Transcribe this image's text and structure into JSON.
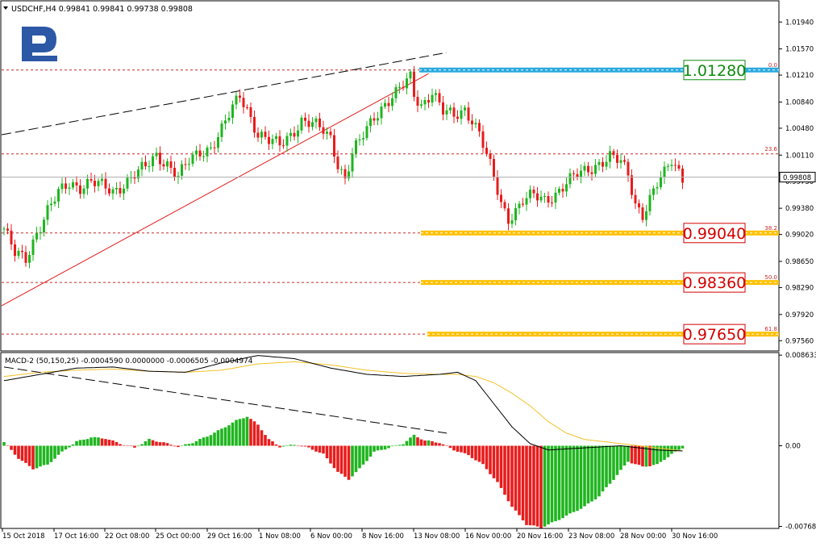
{
  "header": {
    "symbol_line": "USDCHF,H4  0.99841 0.99841 0.99738 0.99808"
  },
  "macd_header": "MACD-2 (50,150,25) -0.0004590 0.0000000 -0.0006505 -0.0004974",
  "colors": {
    "bull": "#1FB51F",
    "bear": "#E81C1C",
    "dashed": "#C62828",
    "blue_zone": "#2AA9DF",
    "orange_zone": "#FFC000",
    "price_box": "#D50000",
    "green_box": "#0E8A0E",
    "logo": "#2C58A6"
  },
  "chart_data": [
    {
      "type": "candlestick",
      "title": "USDCHF,H4",
      "ylim": [
        0.9743,
        1.0222
      ],
      "y_ticks": [
        "1.01940",
        "1.01570",
        "1.01210",
        "1.00840",
        "1.00480",
        "1.00110",
        "0.99750",
        "0.99380",
        "0.99020",
        "0.98650",
        "0.98290",
        "0.97920",
        "0.97560"
      ],
      "current_price": "0.99808",
      "x_ticks": [
        "15 Oct 2018",
        "17 Oct 16:00",
        "22 Oct 08:00",
        "25 Oct 00:00",
        "29 Oct 16:00",
        "1 Nov 08:00",
        "6 Nov 00:00",
        "8 Nov 16:00",
        "13 Nov 08:00",
        "16 Nov 00:00",
        "20 Nov 16:00",
        "23 Nov 08:00",
        "28 Nov 00:00",
        "30 Nov 16:00"
      ],
      "close_path": [
        [
          0,
          0.991
        ],
        [
          3,
          0.9875
        ],
        [
          6,
          0.9868
        ],
        [
          9,
          0.9905
        ],
        [
          12,
          0.9935
        ],
        [
          15,
          0.9958
        ],
        [
          18,
          0.9972
        ],
        [
          21,
          0.9968
        ],
        [
          24,
          0.9975
        ],
        [
          27,
          0.9968
        ],
        [
          30,
          0.996
        ],
        [
          33,
          0.9972
        ],
        [
          36,
          0.9985
        ],
        [
          39,
          0.9994
        ],
        [
          42,
          1.001
        ],
        [
          45,
          1.0
        ],
        [
          48,
          0.9982
        ],
        [
          51,
          1.0002
        ],
        [
          54,
          1.0015
        ],
        [
          57,
          1.0022
        ],
        [
          60,
          1.0046
        ],
        [
          63,
          1.0075
        ],
        [
          65,
          1.0093
        ],
        [
          67,
          1.0075
        ],
        [
          70,
          1.004
        ],
        [
          73,
          1.003
        ],
        [
          76,
          1.0025
        ],
        [
          79,
          1.004
        ],
        [
          82,
          1.0058
        ],
        [
          85,
          1.0053
        ],
        [
          88,
          1.0045
        ],
        [
          90,
          1.0035
        ],
        [
          92,
          1.0
        ],
        [
          94,
          0.9978
        ],
        [
          96,
          1.0012
        ],
        [
          99,
          1.0038
        ],
        [
          102,
          1.0065
        ],
        [
          105,
          1.0082
        ],
        [
          108,
          1.0095
        ],
        [
          110,
          1.0106
        ],
        [
          112,
          1.0118
        ],
        [
          113,
          1.0095
        ],
        [
          115,
          1.008
        ],
        [
          118,
          1.0098
        ],
        [
          121,
          1.007
        ],
        [
          124,
          1.0065
        ],
        [
          127,
          1.0075
        ],
        [
          129,
          1.006
        ],
        [
          131,
          1.004
        ],
        [
          133,
          1.001
        ],
        [
          135,
          0.998
        ],
        [
          137,
          0.9945
        ],
        [
          139,
          0.9925
        ],
        [
          141,
          0.9935
        ],
        [
          143,
          0.9948
        ],
        [
          146,
          0.9955
        ],
        [
          149,
          0.995
        ],
        [
          152,
          0.9958
        ],
        [
          155,
          0.9972
        ],
        [
          158,
          0.9984
        ],
        [
          161,
          0.9992
        ],
        [
          164,
          1.0
        ],
        [
          167,
          1.0008
        ],
        [
          170,
          1.0001
        ],
        [
          172,
          0.9985
        ],
        [
          174,
          0.9945
        ],
        [
          176,
          0.993
        ],
        [
          178,
          0.995
        ],
        [
          180,
          0.997
        ],
        [
          182,
          0.9985
        ],
        [
          184,
          1.0005
        ],
        [
          186,
          0.999
        ],
        [
          187,
          0.9981
        ]
      ],
      "n_candles": 188,
      "trendlines": {
        "resistance": {
          "from": [
            0,
            1.0039
          ],
          "to": [
            122,
            1.0152
          ]
        },
        "support": {
          "from": [
            0,
            0.9804
          ],
          "to": [
            117,
            1.0123
          ]
        }
      },
      "fibonacci": [
        {
          "level": "0.0",
          "price": 1.0128,
          "label": "1.01280",
          "zone": "blue"
        },
        {
          "level": "23.6",
          "price": 1.00127,
          "label": "",
          "zone": ""
        },
        {
          "level": "38.2",
          "price": 0.9904,
          "label": "0.99040",
          "zone": "orange"
        },
        {
          "level": "50.0",
          "price": 0.9836,
          "label": "0.98360",
          "zone": "orange"
        },
        {
          "level": "61.8",
          "price": 0.9765,
          "label": "0.97650",
          "zone": "orange"
        }
      ]
    },
    {
      "type": "histogram",
      "title": "MACD-2 (50,150,25)",
      "ylim": [
        -0.0078,
        0.0088
      ],
      "y_ticks": [
        "0.008633",
        "0.00",
        "-0.007682"
      ],
      "hist_path": [
        [
          0,
          0.00035
        ],
        [
          4,
          -0.0012
        ],
        [
          8,
          -0.0022
        ],
        [
          12,
          -0.0018
        ],
        [
          16,
          -0.0006
        ],
        [
          20,
          0.0004
        ],
        [
          24,
          0.0008
        ],
        [
          28,
          0.0007
        ],
        [
          32,
          0.0002
        ],
        [
          36,
          -0.0002
        ],
        [
          40,
          0.0006
        ],
        [
          44,
          0.0003
        ],
        [
          48,
          -0.0001
        ],
        [
          52,
          0.0003
        ],
        [
          56,
          0.0009
        ],
        [
          60,
          0.0016
        ],
        [
          64,
          0.0024
        ],
        [
          67,
          0.0028
        ],
        [
          70,
          0.002
        ],
        [
          73,
          0.0006
        ],
        [
          76,
          -0.0001
        ],
        [
          80,
          0.0001
        ],
        [
          84,
          -0.0002
        ],
        [
          88,
          -0.0008
        ],
        [
          92,
          -0.0025
        ],
        [
          95,
          -0.0032
        ],
        [
          98,
          -0.0022
        ],
        [
          102,
          -0.0006
        ],
        [
          106,
          -0.0002
        ],
        [
          110,
          0.0002
        ],
        [
          113,
          0.001
        ],
        [
          116,
          0.0005
        ],
        [
          120,
          0.0003
        ],
        [
          124,
          -0.0004
        ],
        [
          128,
          -0.0009
        ],
        [
          132,
          -0.0018
        ],
        [
          136,
          -0.0035
        ],
        [
          140,
          -0.0058
        ],
        [
          144,
          -0.0075
        ],
        [
          148,
          -0.0078
        ],
        [
          152,
          -0.0072
        ],
        [
          156,
          -0.0065
        ],
        [
          160,
          -0.0058
        ],
        [
          164,
          -0.0048
        ],
        [
          168,
          -0.0032
        ],
        [
          172,
          -0.0015
        ],
        [
          176,
          -0.002
        ],
        [
          180,
          -0.0018
        ],
        [
          184,
          -0.0008
        ],
        [
          187,
          -0.0002
        ]
      ],
      "main_path": [
        [
          0,
          0.0062
        ],
        [
          10,
          0.0068
        ],
        [
          20,
          0.0074
        ],
        [
          30,
          0.0075
        ],
        [
          40,
          0.0071
        ],
        [
          50,
          0.007
        ],
        [
          60,
          0.0079
        ],
        [
          70,
          0.0086
        ],
        [
          80,
          0.0083
        ],
        [
          90,
          0.0074
        ],
        [
          100,
          0.0068
        ],
        [
          110,
          0.0066
        ],
        [
          120,
          0.0068
        ],
        [
          125,
          0.007
        ],
        [
          130,
          0.0062
        ],
        [
          135,
          0.004
        ],
        [
          140,
          0.0018
        ],
        [
          145,
          0.0002
        ],
        [
          150,
          -0.0004
        ],
        [
          160,
          -0.0002
        ],
        [
          170,
          0.0
        ],
        [
          180,
          -0.0004
        ],
        [
          187,
          -0.0005
        ]
      ],
      "signal_path": [
        [
          0,
          0.0066
        ],
        [
          10,
          0.007
        ],
        [
          20,
          0.0072
        ],
        [
          30,
          0.0073
        ],
        [
          40,
          0.0071
        ],
        [
          50,
          0.007
        ],
        [
          60,
          0.0072
        ],
        [
          70,
          0.0078
        ],
        [
          80,
          0.008
        ],
        [
          90,
          0.0077
        ],
        [
          100,
          0.0072
        ],
        [
          110,
          0.0069
        ],
        [
          120,
          0.0068
        ],
        [
          125,
          0.0068
        ],
        [
          130,
          0.0066
        ],
        [
          135,
          0.006
        ],
        [
          140,
          0.005
        ],
        [
          145,
          0.0038
        ],
        [
          150,
          0.0023
        ],
        [
          155,
          0.0012
        ],
        [
          160,
          0.0006
        ],
        [
          170,
          0.0002
        ],
        [
          180,
          -0.0002
        ],
        [
          187,
          -0.0005
        ]
      ],
      "trendline": {
        "from": [
          0,
          0.0075
        ],
        "to": [
          122,
          0.0012
        ]
      }
    }
  ]
}
